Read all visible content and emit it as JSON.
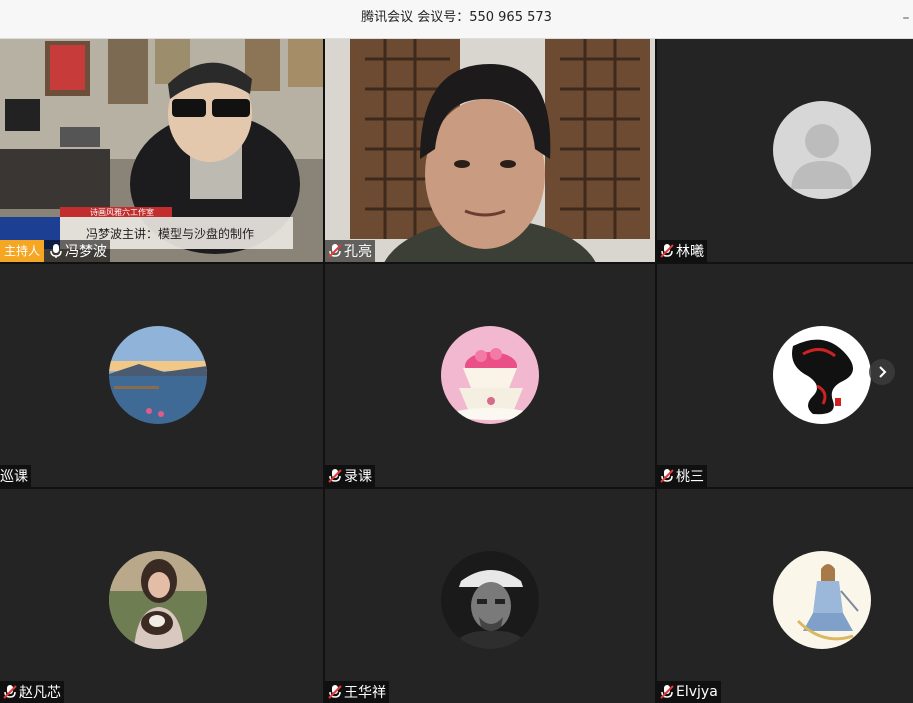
{
  "window": {
    "title": "腾讯会议 会议号：550 965 573",
    "minimize_glyph": "–"
  },
  "host_badge": "主持人",
  "tiles": [
    {
      "name": "冯梦波",
      "mic": "on",
      "host": true,
      "kind": "video-feed",
      "video_banner": "冯梦波主讲：模型与沙盘的制作",
      "video_ribbon": "诗画风雅六工作室"
    },
    {
      "name": "孔亮",
      "mic": "muted",
      "host": false,
      "kind": "video-feed"
    },
    {
      "name": "林曦",
      "mic": "muted",
      "host": false,
      "kind": "default-avatar"
    },
    {
      "name": "巡课",
      "mic": "none",
      "host": false,
      "kind": "lake-avatar"
    },
    {
      "name": "录课",
      "mic": "muted",
      "host": false,
      "kind": "teacup-avatar"
    },
    {
      "name": "桃三",
      "mic": "muted",
      "host": false,
      "kind": "dragon-avatar"
    },
    {
      "name": "赵凡芯",
      "mic": "muted",
      "host": false,
      "kind": "photo-avatar"
    },
    {
      "name": "王华祥",
      "mic": "muted",
      "host": false,
      "kind": "bw-portrait-avatar"
    },
    {
      "name": "Elvjya",
      "mic": "muted",
      "host": false,
      "kind": "drawing-avatar"
    }
  ],
  "colors": {
    "tile_bg": "#242424",
    "host_badge": "#f5a623",
    "muted_mic": "#e03a3a"
  },
  "icons": {
    "next_page": "chevron-right-icon",
    "mic_on": "microphone-icon",
    "mic_muted": "microphone-muted-icon"
  }
}
